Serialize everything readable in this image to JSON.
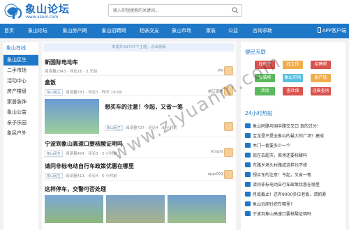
{
  "header": {
    "logo_title": "象山论坛",
    "logo_url": "www.xsool.com",
    "search_placeholder": "输入你想搜索的关键词..."
  },
  "nav": {
    "items": [
      "首页",
      "象山论坛",
      "象山房产网",
      "象山招聘网",
      "相亲交友",
      "象山市场",
      "家装",
      "公益",
      "咨询求助"
    ],
    "app_label": "APP客户端"
  },
  "sidebar": {
    "title": "象山在线",
    "items": [
      "象山民生",
      "二手市场",
      "活动中心",
      "房产楼盘",
      "家居装饰",
      "象山公益",
      "亲子乐园",
      "象民户外"
    ]
  },
  "feed": {
    "notice": "本版共39727个主题，点击刷新",
    "posts": [
      {
        "title": "新国际电动车",
        "meta": "阅读量2343 · 评论16 · 3 天前",
        "user": "jay"
      },
      {
        "title": "盒饭",
        "tag": "象山民生",
        "meta": "阅读量781 · 评论3 · 昨天 19:56",
        "user": "桃江富先"
      },
      {
        "title": "想买车的注意！今起，又省一笔",
        "tag": "象山民生",
        "meta": "阅读量727 · 评论4 · 9 小时前",
        "user": ""
      },
      {
        "title": "宁波到象山高速口要核酸证明吗",
        "tag": "象山民生",
        "meta": "阅读量454 · 评论3 · 5 小时前",
        "user": "Knight"
      },
      {
        "title": "请问非标电动自行车政策优惠在哪里",
        "tag": "象山民生",
        "meta": "阅读量411 · 评论4 · 5 小时前",
        "user": "ajqn001"
      },
      {
        "title": "这样停车，交警可否处理",
        "tag": "",
        "meta": "",
        "user": ""
      }
    ]
  },
  "right": {
    "tags_title": "便民互联",
    "tags": [
      {
        "label": "找房子",
        "color": "#d9534f"
      },
      {
        "label": "找工作",
        "color": "#f0ad4e"
      },
      {
        "label": "招聘帮",
        "color": "#d9534f"
      },
      {
        "label": "爱装修",
        "color": "#5cb85c"
      },
      {
        "label": "象山市场",
        "color": "#5bc0de"
      },
      {
        "label": "家产链",
        "color": "#f0ad4e"
      },
      {
        "label": "活动",
        "color": "#5cb85c"
      },
      {
        "label": "查社保",
        "color": "#d9534f"
      },
      {
        "label": "违章查询",
        "color": "#d9534f"
      }
    ],
    "hot_title": "24小时热贴",
    "hot": [
      "象山同路与国中路交叉口 真的过分！",
      "宝龙是不是全象山的最大的广场？建成",
      "木门一套要多少一个",
      "现在去超市，菜场还要核酸吗",
      "东路乡场头村路成这样也不修",
      "想买车的注意！今起，又省一笔",
      "请问非标电动自行车政策优惠在哪里",
      "月底截止！还有9000多位老板，请抓紧",
      "象山远朋针织在哪里?",
      "宁波到象山高速口要核酸证明吗"
    ]
  },
  "watermark": "www.ziyuanm.com",
  "colors": {
    "brand": "#1e78c7",
    "accent_red": "#d9534f"
  }
}
